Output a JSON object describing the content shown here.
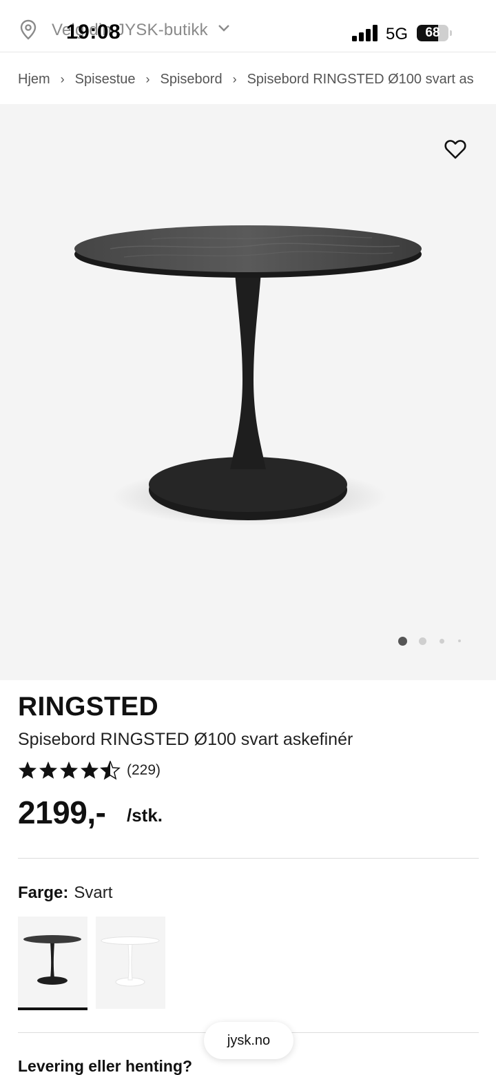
{
  "status_bar": {
    "time": "19:08",
    "network": "5G",
    "battery_level": "68",
    "battery_fraction": 0.68
  },
  "store_picker": {
    "label": "Velg din JYSK-butikk"
  },
  "breadcrumb": [
    "Hjem",
    "Spisestue",
    "Spisebord",
    "Spisebord RINGSTED Ø100 svart as"
  ],
  "gallery": {
    "image_count": 4,
    "active_index": 0
  },
  "product": {
    "name": "RINGSTED",
    "description": "Spisebord RINGSTED Ø100 svart askefinér",
    "rating_stars": 4.5,
    "rating_max": 5,
    "review_count": "(229)",
    "price": "2199,-",
    "unit": "/stk."
  },
  "color": {
    "label": "Farge:",
    "selected": "Svart",
    "options": [
      "Svart",
      "Hvit"
    ]
  },
  "delivery": {
    "heading": "Levering eller henting?"
  },
  "browser": {
    "url": "jysk.no"
  },
  "colors": {
    "background": "#ffffff",
    "hero_bg": "#f4f4f4",
    "text": "#111111",
    "muted": "#8a8a8a"
  }
}
